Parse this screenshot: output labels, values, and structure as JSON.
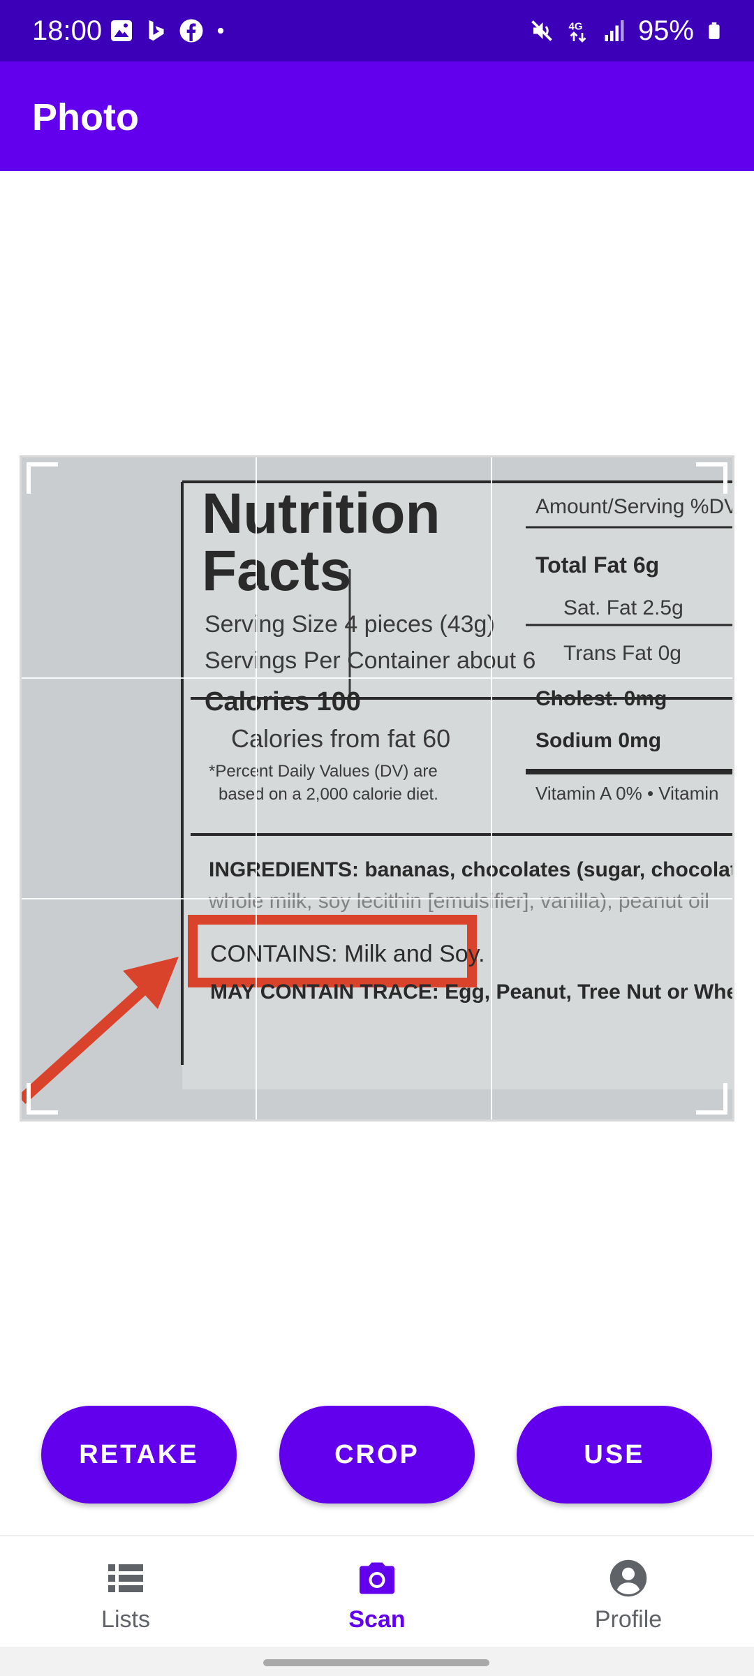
{
  "status_bar": {
    "time": "18:00",
    "battery": "95%",
    "left_icons": [
      "gallery-icon",
      "bing-icon",
      "facebook-icon",
      "dot-icon"
    ],
    "right_icons": [
      "mute-icon",
      "4g-icon",
      "signal-icon",
      "battery-icon"
    ]
  },
  "app_bar": {
    "title": "Photo"
  },
  "photo": {
    "label_title_1": "Nutrition",
    "label_title_2": "Facts",
    "serving_size": "Serving Size 4 pieces (43g)",
    "servings_per_container": "Servings Per Container about 6",
    "calories": "Calories 100",
    "calories_from_fat": "Calories from fat 60",
    "dv_note_1": "*Percent Daily Values (DV) are",
    "dv_note_2": "based on a 2,000 calorie diet.",
    "amount_serving": "Amount/Serving %DV",
    "total_fat": "Total Fat 6g",
    "sat_fat": "Sat. Fat 2.5g",
    "trans_fat": "Trans Fat 0g",
    "cholest": "Cholest. 0mg",
    "sodium": "Sodium 0mg",
    "vitamins": "Vitamin A 0% • Vitamin",
    "ingredients": "INGREDIENTS: bananas, chocolates (sugar, chocolate li",
    "ingredients_2": "whole milk, soy lecithin [emulsifier], vanilla), peanut oil",
    "contains": "CONTAINS: Milk and Soy.",
    "may_contain": "MAY CONTAIN TRACE: Egg, Peanut, Tree Nut or Wheat Pro"
  },
  "actions": {
    "retake": "RETAKE",
    "crop": "CROP",
    "use": "USE"
  },
  "bottom_nav": {
    "items": [
      {
        "label": "Lists",
        "icon": "list-icon",
        "active": false
      },
      {
        "label": "Scan",
        "icon": "camera-icon",
        "active": true
      },
      {
        "label": "Profile",
        "icon": "account-circle-icon",
        "active": false
      }
    ]
  },
  "colors": {
    "status_bar": "#3b00b8",
    "primary": "#6200ee",
    "label_red": "#d9432b"
  }
}
